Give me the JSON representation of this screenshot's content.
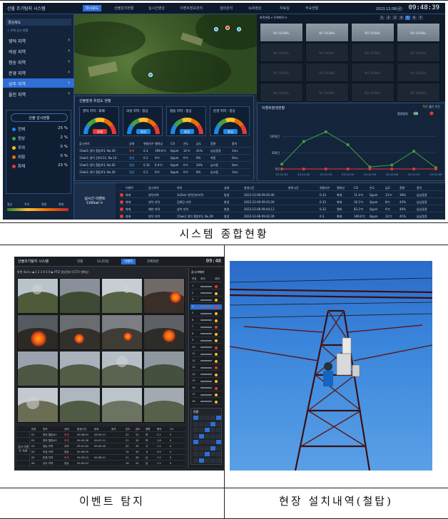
{
  "captions": {
    "top": "시스템 종합현황",
    "bottom_left": "이벤트 탐지",
    "bottom_right": "현장 설치내역(철탑)"
  },
  "dashboard": {
    "logo": "산불 조기탐지 시스템",
    "tabs": [
      "대시보드",
      "산불감지현황",
      "실시간영상",
      "이벤트정보관리",
      "설비관리",
      "녹화영상",
      "자료실",
      "주요현황"
    ],
    "active_tab": 0,
    "date": "2023.12.08(금)",
    "clock": "09:48:39",
    "sidebar": {
      "header": "경상북도",
      "sub": "> 전체 감시 현황",
      "items": [
        "영덕 지역",
        "의성 지역",
        "청송 지역",
        "문경 지역",
        "상주 지역",
        "울진 지역"
      ],
      "active_index": 4
    },
    "status_panel": {
      "title": "산불 감시현황",
      "rows": [
        {
          "label": "전체",
          "value": "25 %",
          "color": "#1e88e5"
        },
        {
          "label": "정상",
          "value": "2 %",
          "color": "#43a047"
        },
        {
          "label": "주의",
          "value": "0 %",
          "color": "#fbc02d"
        },
        {
          "label": "위험",
          "value": "0 %",
          "color": "#ef6c00"
        },
        {
          "label": "화재",
          "value": "23 %",
          "color": "#e53935"
        }
      ],
      "legend": [
        "정상",
        "주의",
        "위험",
        "화재"
      ]
    },
    "camera_toolbar": "화면분할 ▾   전체화면   ⟳",
    "camera_pages": [
      "1",
      "2",
      "3",
      "4",
      "5",
      "6",
      "7"
    ],
    "camera_cell_label": "NO SIGNAL",
    "risk_panel": {
      "title": "산불발생 위험도 현황",
      "gauges": [
        {
          "label": "영덕 지역 : 화재",
          "state": "화재"
        },
        {
          "label": "의성 지역 : 정상",
          "state": "정상"
        },
        {
          "label": "청송 지역 : 정상",
          "state": "정상"
        },
        {
          "label": "문경 지역 : 정상",
          "state": "정상"
        }
      ],
      "headers": [
        "감시위치",
        "상태",
        "위험지수",
        "열화상",
        "CO",
        "온도",
        "습도",
        "풍향",
        "풍속"
      ],
      "rows": [
        [
          "15wk1 영덕 철탑#3, No.29",
          "화재",
          "0.3",
          "199.0℃",
          "0ppm",
          "12℃",
          "41%",
          "남남동풍",
          "1ms"
        ],
        [
          "15wk1 영덕 진보111, No.14",
          "정상",
          "0.3",
          "0℃",
          "0ppm",
          "0℃",
          "0%",
          "북풍",
          "0ms"
        ],
        [
          "15wk1 영덕 철탑#3, No.02",
          "정상",
          "0.32",
          "6.4℃",
          "0ppm",
          "0℃",
          "34%",
          "남서풍",
          "0ms"
        ],
        [
          "15wk1 영덕 철탑#3, No.29",
          "정상",
          "0.3",
          "0℃",
          "0ppm",
          "0℃",
          "0%",
          "남서풍",
          "1ms"
        ]
      ]
    },
    "trend_panel": {
      "title": "이벤트발생현황",
      "tabs": [
        "주간",
        "월간",
        "년간"
      ],
      "legend": [
        "정상탐지",
        "화재"
      ]
    },
    "events": {
      "label": "실시간 이벤트\nCritical >",
      "headers": [
        "이벤트",
        "감시위치",
        "위치",
        "상태",
        "발생시간",
        "완료시간",
        "위험지수",
        "열화상",
        "CO",
        "온도",
        "습도",
        "풍향",
        "풍속"
      ],
      "rows": [
        [
          "화재",
          "영덕지역",
          "3x5km 영덕진보지역",
          "발생",
          "2023-12-08 09:45:46",
          "",
          "0.33",
          "화재",
          "11.4℃",
          "0ppm",
          "13℃",
          "38%",
          "남남동풍"
        ],
        [
          "화재",
          "영덕 지역",
          "김해진 지역",
          "발생",
          "2023-12-08 09:45:26",
          "",
          "0.33",
          "화재",
          "16.2℃",
          "0ppm",
          "8℃",
          "43%",
          "남남동풍"
        ],
        [
          "화재",
          "예천 지역",
          "삼척 지역",
          "발생",
          "2023-12-08 09:44:13",
          "",
          "0.33",
          "열화",
          "83.2℃",
          "0ppm",
          "6℃",
          "49%",
          "남남동풍"
        ],
        [
          "화재",
          "영덕 지역",
          "15wk1 영덕 철탑#3, No.29",
          "발생",
          "2023-12-08 09:42:39",
          "",
          "0.3",
          "화재",
          "199.0℃",
          "0ppm",
          "12℃",
          "41%",
          "남남동풍"
        ]
      ]
    }
  },
  "chart_data": {
    "type": "line",
    "title": "",
    "xlabel": "",
    "ylabel": "",
    "categories": [
      "23-12-01",
      "23-12-02",
      "23-12-03",
      "23-12-04",
      "23-12-05",
      "23-12-06",
      "23-12-07",
      "23-12-08"
    ],
    "ylim": [
      0,
      1500
    ],
    "ytick_labels": [
      "0건",
      "500건",
      "1000건"
    ],
    "series": [
      {
        "name": "정상탐지",
        "values": [
          150,
          850,
          1150,
          750,
          60,
          120,
          550,
          40
        ],
        "color": "#43a047"
      },
      {
        "name": "화재",
        "values": [
          0,
          0,
          0,
          0,
          0,
          0,
          0,
          0
        ],
        "color": "#e53935"
      }
    ]
  },
  "event_detection": {
    "logo": "산불조기탐지 시스템",
    "tabs": [
      "현황",
      "모니터링",
      "이벤트",
      "관제화면"
    ],
    "active_tab": 2,
    "clock": "09:48",
    "toolbar": "화면 4x4 ▾  ◀ 1 2 3 4 5 6 ▶  PTZ  영상정보  CCTV  열화상",
    "side_title": "감시카메라",
    "side_headers": [
      "번호",
      "위치",
      "상태"
    ],
    "side_rows": [
      "1",
      "2",
      "3",
      "4",
      "5",
      "6",
      "7",
      "8",
      "9",
      "10",
      "11",
      "12",
      "13",
      "14",
      "15",
      "16",
      "17",
      "18"
    ],
    "side_box_title": "현황",
    "table_label": "감지 이벤트 목록",
    "table_headers": [
      "번호",
      "위치",
      "상태",
      "발생시간",
      "완료",
      "위치",
      "온도",
      "습도",
      "풍향",
      "풍속",
      "CO"
    ],
    "table_rows": [
      [
        "01",
        "영덕 철탑#1",
        "화재",
        "09:48:01",
        "09:50:11",
        "",
        "22",
        "31",
        "북",
        "2.1",
        "0"
      ],
      [
        "02",
        "영덕 철탑#2",
        "화재",
        "09:45:26",
        "09:47:11",
        "",
        "21",
        "33",
        "북",
        "1.8",
        "0"
      ],
      [
        "03",
        "청송 지역",
        "주의",
        "09:41:02",
        "09:44:40",
        "",
        "20",
        "35",
        "서",
        "1.2",
        "0"
      ],
      [
        "04",
        "의성 지역",
        "정상",
        "09:38:55",
        "",
        "",
        "19",
        "39",
        "서",
        "0.9",
        "0"
      ],
      [
        "05",
        "문경 지역",
        "화재",
        "09:33:10",
        "09:36:21",
        "",
        "21",
        "38",
        "남",
        "1.5",
        "0"
      ],
      [
        "06",
        "상주 지역",
        "정상",
        "09:30:47",
        "",
        "",
        "18",
        "41",
        "남",
        "1.1",
        "0"
      ]
    ]
  }
}
